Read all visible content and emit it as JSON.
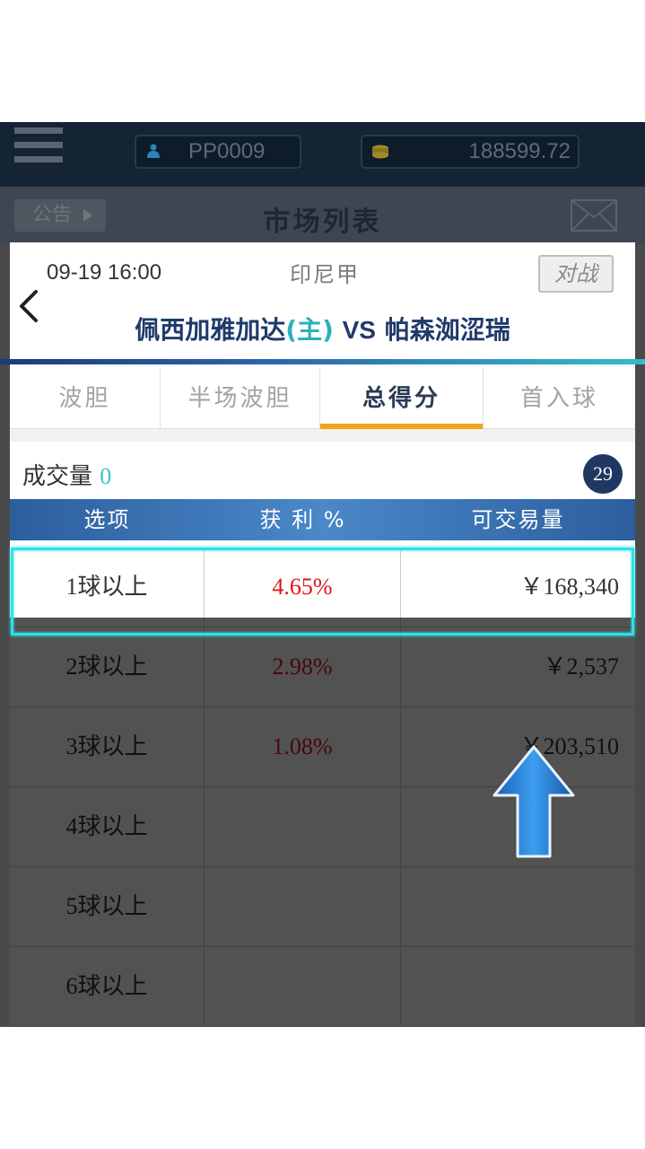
{
  "topbar": {
    "username": "PP0009",
    "balance": "188599.72",
    "icons": [
      "menu-icon",
      "user-icon",
      "coin-icon"
    ]
  },
  "subbar": {
    "notice_label": "公告",
    "title": "市场列表",
    "icons": [
      "play-icon",
      "mail-icon"
    ]
  },
  "match": {
    "time": "09-19 16:00",
    "league": "印尼甲",
    "vs_button": "对战",
    "home_team": "佩西加雅加达",
    "home_marker": "(主)",
    "vs": "VS",
    "away_team": "帕森洳涩瑞"
  },
  "tabs": [
    {
      "label": "波胆",
      "active": false
    },
    {
      "label": "半场波胆",
      "active": false
    },
    {
      "label": "总得分",
      "active": true
    },
    {
      "label": "首入球",
      "active": false
    }
  ],
  "volume": {
    "label": "成交量",
    "value": "0",
    "badge": "29"
  },
  "table": {
    "headers": [
      "选项",
      "获 利 %",
      "可交易量"
    ],
    "rows": [
      {
        "option": "1球以上",
        "profit": "4.65%",
        "amount": "￥168,340"
      },
      {
        "option": "2球以上",
        "profit": "2.98%",
        "amount": "￥2,537"
      },
      {
        "option": "3球以上",
        "profit": "1.08%",
        "amount": "￥203,510"
      },
      {
        "option": "4球以上",
        "profit": "",
        "amount": ""
      },
      {
        "option": "5球以上",
        "profit": "",
        "amount": ""
      },
      {
        "option": "6球以上",
        "profit": "",
        "amount": ""
      }
    ]
  },
  "colors": {
    "accent": "#2ee0e8",
    "profit_red": "#e0161b",
    "tab_active": "#f2a517",
    "header_blue": "#2c5e9e"
  }
}
